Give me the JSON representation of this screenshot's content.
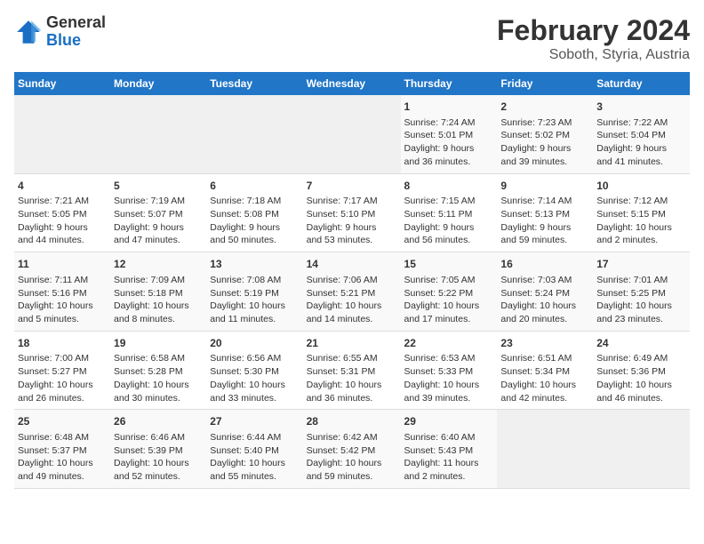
{
  "header": {
    "logo_general": "General",
    "logo_blue": "Blue",
    "month_title": "February 2024",
    "location": "Soboth, Styria, Austria"
  },
  "calendar": {
    "weekdays": [
      "Sunday",
      "Monday",
      "Tuesday",
      "Wednesday",
      "Thursday",
      "Friday",
      "Saturday"
    ],
    "weeks": [
      [
        {
          "day": "",
          "info": ""
        },
        {
          "day": "",
          "info": ""
        },
        {
          "day": "",
          "info": ""
        },
        {
          "day": "",
          "info": ""
        },
        {
          "day": "1",
          "info": "Sunrise: 7:24 AM\nSunset: 5:01 PM\nDaylight: 9 hours\nand 36 minutes."
        },
        {
          "day": "2",
          "info": "Sunrise: 7:23 AM\nSunset: 5:02 PM\nDaylight: 9 hours\nand 39 minutes."
        },
        {
          "day": "3",
          "info": "Sunrise: 7:22 AM\nSunset: 5:04 PM\nDaylight: 9 hours\nand 41 minutes."
        }
      ],
      [
        {
          "day": "4",
          "info": "Sunrise: 7:21 AM\nSunset: 5:05 PM\nDaylight: 9 hours\nand 44 minutes."
        },
        {
          "day": "5",
          "info": "Sunrise: 7:19 AM\nSunset: 5:07 PM\nDaylight: 9 hours\nand 47 minutes."
        },
        {
          "day": "6",
          "info": "Sunrise: 7:18 AM\nSunset: 5:08 PM\nDaylight: 9 hours\nand 50 minutes."
        },
        {
          "day": "7",
          "info": "Sunrise: 7:17 AM\nSunset: 5:10 PM\nDaylight: 9 hours\nand 53 minutes."
        },
        {
          "day": "8",
          "info": "Sunrise: 7:15 AM\nSunset: 5:11 PM\nDaylight: 9 hours\nand 56 minutes."
        },
        {
          "day": "9",
          "info": "Sunrise: 7:14 AM\nSunset: 5:13 PM\nDaylight: 9 hours\nand 59 minutes."
        },
        {
          "day": "10",
          "info": "Sunrise: 7:12 AM\nSunset: 5:15 PM\nDaylight: 10 hours\nand 2 minutes."
        }
      ],
      [
        {
          "day": "11",
          "info": "Sunrise: 7:11 AM\nSunset: 5:16 PM\nDaylight: 10 hours\nand 5 minutes."
        },
        {
          "day": "12",
          "info": "Sunrise: 7:09 AM\nSunset: 5:18 PM\nDaylight: 10 hours\nand 8 minutes."
        },
        {
          "day": "13",
          "info": "Sunrise: 7:08 AM\nSunset: 5:19 PM\nDaylight: 10 hours\nand 11 minutes."
        },
        {
          "day": "14",
          "info": "Sunrise: 7:06 AM\nSunset: 5:21 PM\nDaylight: 10 hours\nand 14 minutes."
        },
        {
          "day": "15",
          "info": "Sunrise: 7:05 AM\nSunset: 5:22 PM\nDaylight: 10 hours\nand 17 minutes."
        },
        {
          "day": "16",
          "info": "Sunrise: 7:03 AM\nSunset: 5:24 PM\nDaylight: 10 hours\nand 20 minutes."
        },
        {
          "day": "17",
          "info": "Sunrise: 7:01 AM\nSunset: 5:25 PM\nDaylight: 10 hours\nand 23 minutes."
        }
      ],
      [
        {
          "day": "18",
          "info": "Sunrise: 7:00 AM\nSunset: 5:27 PM\nDaylight: 10 hours\nand 26 minutes."
        },
        {
          "day": "19",
          "info": "Sunrise: 6:58 AM\nSunset: 5:28 PM\nDaylight: 10 hours\nand 30 minutes."
        },
        {
          "day": "20",
          "info": "Sunrise: 6:56 AM\nSunset: 5:30 PM\nDaylight: 10 hours\nand 33 minutes."
        },
        {
          "day": "21",
          "info": "Sunrise: 6:55 AM\nSunset: 5:31 PM\nDaylight: 10 hours\nand 36 minutes."
        },
        {
          "day": "22",
          "info": "Sunrise: 6:53 AM\nSunset: 5:33 PM\nDaylight: 10 hours\nand 39 minutes."
        },
        {
          "day": "23",
          "info": "Sunrise: 6:51 AM\nSunset: 5:34 PM\nDaylight: 10 hours\nand 42 minutes."
        },
        {
          "day": "24",
          "info": "Sunrise: 6:49 AM\nSunset: 5:36 PM\nDaylight: 10 hours\nand 46 minutes."
        }
      ],
      [
        {
          "day": "25",
          "info": "Sunrise: 6:48 AM\nSunset: 5:37 PM\nDaylight: 10 hours\nand 49 minutes."
        },
        {
          "day": "26",
          "info": "Sunrise: 6:46 AM\nSunset: 5:39 PM\nDaylight: 10 hours\nand 52 minutes."
        },
        {
          "day": "27",
          "info": "Sunrise: 6:44 AM\nSunset: 5:40 PM\nDaylight: 10 hours\nand 55 minutes."
        },
        {
          "day": "28",
          "info": "Sunrise: 6:42 AM\nSunset: 5:42 PM\nDaylight: 10 hours\nand 59 minutes."
        },
        {
          "day": "29",
          "info": "Sunrise: 6:40 AM\nSunset: 5:43 PM\nDaylight: 11 hours\nand 2 minutes."
        },
        {
          "day": "",
          "info": ""
        },
        {
          "day": "",
          "info": ""
        }
      ]
    ]
  }
}
